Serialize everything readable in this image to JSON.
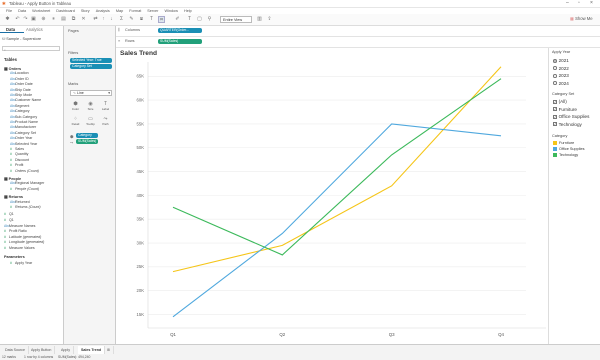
{
  "window": {
    "title": "Tableau - Apply Button in Tableau"
  },
  "menu": [
    "File",
    "Data",
    "Worksheet",
    "Dashboard",
    "Story",
    "Analysis",
    "Map",
    "Format",
    "Server",
    "Window",
    "Help"
  ],
  "toolbar": {
    "view_select": "Entire View",
    "show_me": "Show Me"
  },
  "data_pane": {
    "tabs": [
      "Data",
      "Analytics"
    ],
    "source": "Sample - Superstore",
    "tables_label": "Tables",
    "groups": [
      {
        "name": "Orders",
        "fields": [
          {
            "name": "Location",
            "kind": "dim"
          },
          {
            "name": "Order ID",
            "kind": "dim"
          },
          {
            "name": "Order Date",
            "kind": "dim"
          },
          {
            "name": "Ship Date",
            "kind": "dim"
          },
          {
            "name": "Ship Mode",
            "kind": "dim"
          },
          {
            "name": "Customer Name",
            "kind": "dim"
          },
          {
            "name": "Segment",
            "kind": "dim"
          },
          {
            "name": "Category",
            "kind": "dim"
          },
          {
            "name": "Sub-Category",
            "kind": "dim"
          },
          {
            "name": "Product Name",
            "kind": "dim"
          },
          {
            "name": "Manufacturer",
            "kind": "dim"
          },
          {
            "name": "Category Set",
            "kind": "dim"
          },
          {
            "name": "Order Year",
            "kind": "dim"
          },
          {
            "name": "Selected Year",
            "kind": "dim"
          },
          {
            "name": "Sales",
            "kind": "mea"
          },
          {
            "name": "Quantity",
            "kind": "mea"
          },
          {
            "name": "Discount",
            "kind": "mea"
          },
          {
            "name": "Profit",
            "kind": "mea"
          },
          {
            "name": "Orders (Count)",
            "kind": "mea"
          }
        ]
      },
      {
        "name": "People",
        "fields": [
          {
            "name": "Regional Manager",
            "kind": "dim"
          },
          {
            "name": "People (Count)",
            "kind": "mea"
          }
        ]
      },
      {
        "name": "Returns",
        "fields": [
          {
            "name": "Returned",
            "kind": "dim"
          },
          {
            "name": "Returns (Count)",
            "kind": "mea"
          }
        ]
      }
    ],
    "extra_fields": [
      {
        "name": "Q1",
        "kind": "mea"
      },
      {
        "name": "Q1",
        "kind": "mea"
      },
      {
        "name": "Measure Names",
        "kind": "dim"
      },
      {
        "name": "Profit Ratio",
        "kind": "mea"
      },
      {
        "name": "Latitude (generated)",
        "kind": "mea"
      },
      {
        "name": "Longitude (generated)",
        "kind": "mea"
      },
      {
        "name": "Measure Values",
        "kind": "mea"
      }
    ],
    "parameters_label": "Parameters",
    "parameters": [
      "Apply Year"
    ]
  },
  "mid_pane": {
    "pages_label": "Pages",
    "filters_label": "Filters",
    "filters": [
      "Selected Year: True",
      "Category Set"
    ],
    "marks_label": "Marks",
    "mark_type": "Line",
    "mark_buttons": [
      "Color",
      "Size",
      "Label",
      "Detail",
      "Tooltip",
      "Path"
    ],
    "mark_pills": [
      "Category",
      "SUM(Sales)"
    ]
  },
  "shelves": {
    "columns_label": "Columns",
    "columns_pill": "QUARTER(Order...",
    "rows_label": "Rows",
    "rows_pill": "SUM(Sales)"
  },
  "chart_data": {
    "type": "line",
    "title": "Sales Trend",
    "categories": [
      "Q1",
      "Q2",
      "Q3",
      "Q4"
    ],
    "y_ticks": [
      "15K",
      "20K",
      "25K",
      "30K",
      "35K",
      "40K",
      "45K",
      "50K",
      "55K",
      "60K",
      "65K"
    ],
    "ylim": [
      13000,
      68000
    ],
    "grid": true,
    "series": [
      {
        "name": "Furniture",
        "color": "#F5C518",
        "values": [
          24000,
          29500,
          42000,
          67000
        ]
      },
      {
        "name": "Office Supplies",
        "color": "#4FA8DE",
        "values": [
          14500,
          32000,
          55000,
          52500
        ]
      },
      {
        "name": "Technology",
        "color": "#3CB95B",
        "values": [
          37500,
          27500,
          48500,
          64500
        ]
      }
    ]
  },
  "right_panel": {
    "param_title": "Apply Year",
    "years": [
      "2021",
      "2022",
      "2023",
      "2024"
    ],
    "selected_year": "2021",
    "catset_title": "Category Set",
    "catset_items": [
      "(All)",
      "Furniture",
      "Office Supplies",
      "Technology"
    ],
    "legend_title": "Category",
    "legend": [
      {
        "name": "Furniture",
        "color": "#F5C518"
      },
      {
        "name": "Office Supplies",
        "color": "#4FA8DE"
      },
      {
        "name": "Technology",
        "color": "#3CB95B"
      }
    ]
  },
  "statusbar": {
    "tabs": [
      "Data Source",
      "Apply Button",
      "Apply",
      "Sales Trend"
    ],
    "active_tab": "Sales Trend",
    "marks_count": "12 marks",
    "rows_cols": "1 row by 4 columns",
    "sum_sales": "SUM(Sales): 494,240"
  }
}
